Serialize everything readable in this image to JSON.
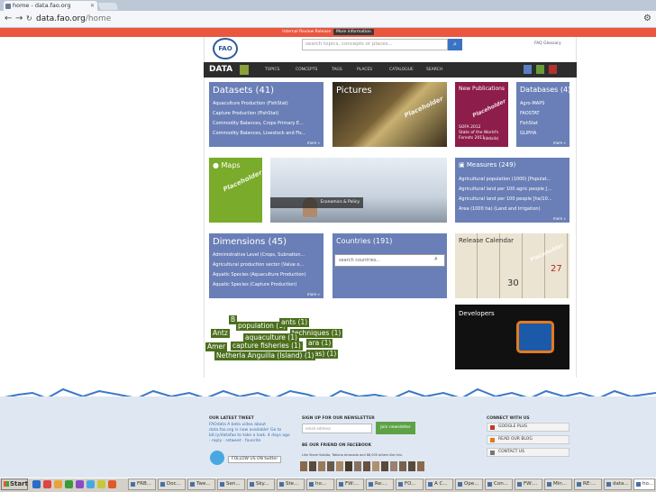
{
  "browser": {
    "tab_title": "home - data.fao.org",
    "url_host": "data.fao.org",
    "url_path": "/home"
  },
  "banner": {
    "text": "Internal Review Release",
    "button": "More information"
  },
  "header": {
    "search_placeholder": "search topics, concepts or places...",
    "faq": "FAQ",
    "glossary": "Glossary"
  },
  "nav": {
    "brand": "DATA",
    "items": [
      "TOPICS",
      "CONCEPTS",
      "TAGS",
      "PLACES",
      "CATALOGUE",
      "SEARCH"
    ]
  },
  "tiles": {
    "datasets": {
      "title": "Datasets (41)",
      "items": [
        "Aquaculture Production (FishStat)",
        "Capture Production (FishStat)",
        "Commodity Balances, Crops Primary E...",
        "Commodity Balances, Livestock and Fis..."
      ],
      "more": "more »"
    },
    "pictures": {
      "title": "Pictures",
      "placeholder": "Placeholder"
    },
    "publications": {
      "title": "New Publications",
      "text": "SOFA 2012\nState of the World's\nForests 2011",
      "link": "(details)",
      "placeholder": "Placeholder"
    },
    "databases": {
      "title": "Databases (4)",
      "items": [
        "Agro-MAPS",
        "FAOSTAT",
        "FishStat",
        "GLIPHA"
      ],
      "more": "more »"
    },
    "maps": {
      "title": "Maps",
      "placeholder": "Placeholder",
      "caption": "Economics & Policy"
    },
    "measures": {
      "title": "Measures (249)",
      "items": [
        "Agricultural population (1000) [Populat...",
        "Agricultural land per 100 agric people [...",
        "Agricultural land per 100 people [ha/10...",
        "Area (1000 ha) (Land and Irrigation)"
      ],
      "more": "more »"
    },
    "dimensions": {
      "title": "Dimensions (45)",
      "items": [
        "Administrative Level (Crops, Subnation...",
        "Agricultural production sector (Value o...",
        "Aquatic Species (Aquaculture Production)",
        "Aquatic Species (Capture Production)"
      ],
      "more": "more »"
    },
    "countries": {
      "title": "Countries (191)",
      "search_placeholder": "search countries..."
    },
    "calendar": {
      "title": "Release Calendar",
      "placeholder": "Placeholder"
    },
    "developers": {
      "title": "Developers"
    }
  },
  "tag_cloud": [
    "population (1)",
    "aquaculture (1)",
    "capture fisheries (1)",
    "Netherla Anguilla (Island) (1)",
    "techniques (1)",
    "Amer",
    "Antz",
    "ara (1)",
    "inas) (1)",
    "ants (1)",
    "B"
  ],
  "footer": {
    "tweet_title": "OUR LATEST TWEET",
    "tweet_text": "FAOdata A beta video about data.fao.org is now available! Go to bit.ly/datafao to take a look. 4 days ago · reply · retweet · favorite",
    "follow": "FOLLOW US ON twitter",
    "newsletter_title": "SIGN UP FOR OUR NEWSLETTER",
    "email_placeholder": "email address",
    "join": "Join newsletter",
    "facebook_title": "BE OUR FRIEND ON FACEBOOK",
    "facebook_text": "Like  Steve Sabido, Tatiana Amorado and 86,000 others like this.",
    "connect_title": "CONNECT WITH US",
    "connect": [
      "GOOGLE PLUS",
      "READ OUR BLOG",
      "CONTACT US"
    ]
  },
  "taskbar": {
    "start": "Start",
    "items": [
      "FRB...",
      "Doc...",
      "Twe...",
      "Sen...",
      "Sky...",
      "Ste...",
      "ho...",
      "FW:...",
      "Re:...",
      "FO...",
      "A C...",
      "Ope...",
      "Con...",
      "FW:...",
      "Min...",
      "RE:...",
      "data...",
      "ho..."
    ]
  }
}
